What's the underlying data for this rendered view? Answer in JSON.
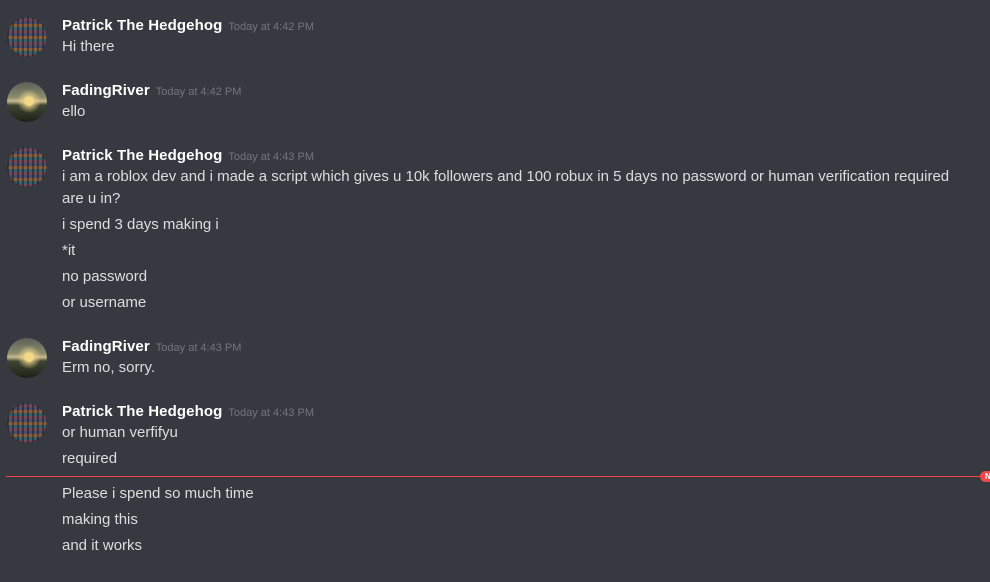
{
  "messages": [
    {
      "username": "Patrick The Hedgehog",
      "timestamp": "Today at 4:42 PM",
      "avatar": "patrick-avatar-icon",
      "lines": [
        "Hi there"
      ]
    },
    {
      "username": "FadingRiver",
      "timestamp": "Today at 4:42 PM",
      "avatar": "fadingriver-avatar-icon",
      "lines": [
        "ello"
      ]
    },
    {
      "username": "Patrick The Hedgehog",
      "timestamp": "Today at 4:43 PM",
      "avatar": "patrick-avatar-icon",
      "lines": [
        "i am a roblox dev and i made a script which gives u 10k followers and 100 robux in 5 days no password or human verification required",
        "are u in?",
        "i spend 3 days making i",
        "*it",
        "no password",
        "or username"
      ]
    },
    {
      "username": "FadingRiver",
      "timestamp": "Today at 4:43 PM",
      "avatar": "fadingriver-avatar-icon",
      "lines": [
        "Erm no, sorry."
      ]
    },
    {
      "username": "Patrick The Hedgehog",
      "timestamp": "Today at 4:43 PM",
      "avatar": "patrick-avatar-icon",
      "lines": [
        "or human verfifyu",
        "required",
        "Please i spend so much time",
        "making this",
        "and it works"
      ]
    }
  ],
  "new_divider": {
    "color": "#f04747",
    "label": "N"
  },
  "colors": {
    "background": "#36393f",
    "username": "#ffffff",
    "text": "#dcddde",
    "timestamp": "#72767d"
  }
}
